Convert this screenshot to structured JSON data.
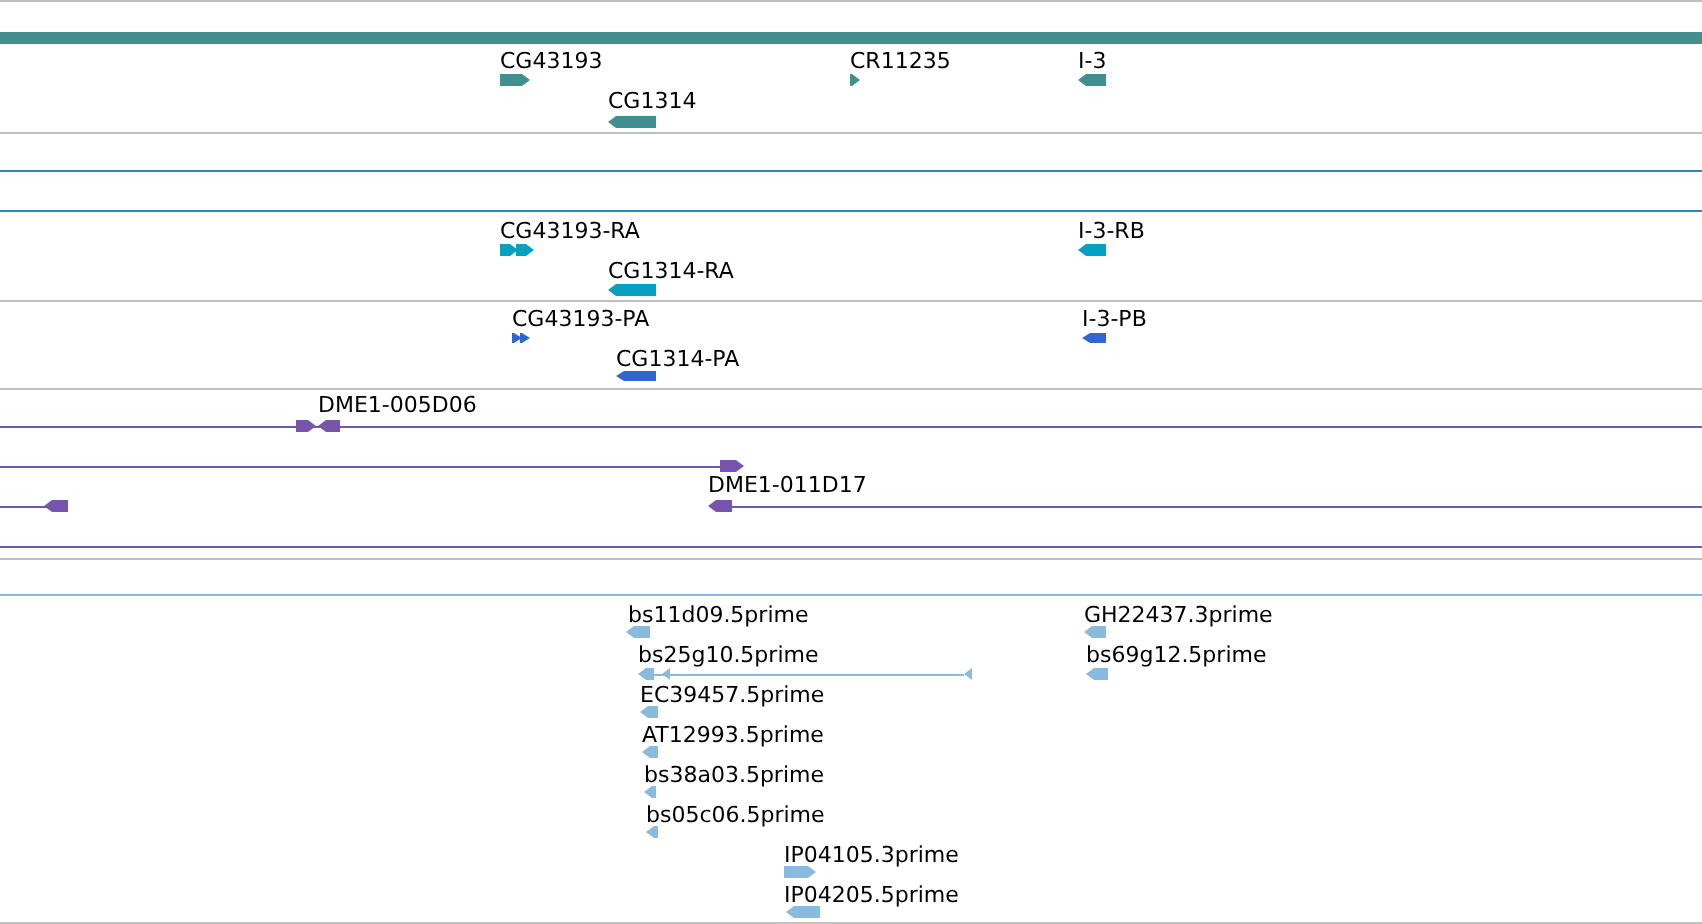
{
  "tracks": [
    {
      "color": "#418f8f",
      "features": [
        {
          "label": "CG43193"
        },
        {
          "label": "CG1314"
        },
        {
          "label": "CR11235"
        },
        {
          "label": "I-3"
        }
      ]
    },
    {
      "color": "#06a0c0",
      "features": [
        {
          "label": "CG43193-RA"
        },
        {
          "label": "CG1314-RA"
        },
        {
          "label": "I-3-RB"
        }
      ]
    },
    {
      "color": "#3366cc",
      "features": [
        {
          "label": "CG43193-PA"
        },
        {
          "label": "CG1314-PA"
        },
        {
          "label": "I-3-PB"
        }
      ]
    },
    {
      "color": "#7755aa",
      "features": [
        {
          "label": "DME1-005D06"
        },
        {
          "label": "DME1-011D17"
        }
      ]
    },
    {
      "color": "#88bbdd",
      "features": [
        {
          "label": "bs11d09.5prime"
        },
        {
          "label": "bs25g10.5prime"
        },
        {
          "label": "EC39457.5prime"
        },
        {
          "label": "AT12993.5prime"
        },
        {
          "label": "bs38a03.5prime"
        },
        {
          "label": "bs05c06.5prime"
        },
        {
          "label": "IP04105.3prime"
        },
        {
          "label": "IP04205.5prime"
        },
        {
          "label": "GH22437.3prime"
        },
        {
          "label": "bs69g12.5prime"
        }
      ]
    }
  ]
}
